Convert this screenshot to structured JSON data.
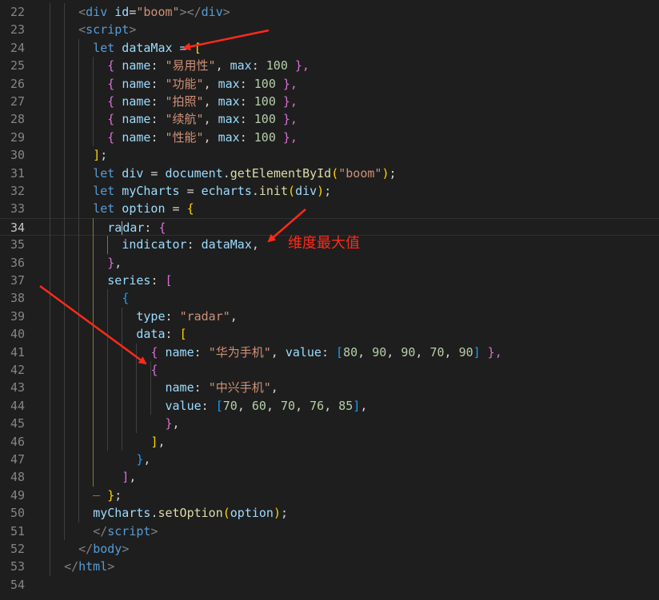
{
  "editor": {
    "lines": [
      {
        "number": "22",
        "tokens": [
          {
            "t": "<",
            "c": "t-brk"
          },
          {
            "t": "div",
            "c": "t-tag"
          },
          {
            "t": " id",
            "c": "t-attr"
          },
          {
            "t": "=",
            "c": "t-p"
          },
          {
            "t": "\"boom\"",
            "c": "t-str"
          },
          {
            "t": "></",
            "c": "t-brk"
          },
          {
            "t": "div",
            "c": "t-tag"
          },
          {
            "t": ">",
            "c": "t-brk"
          }
        ]
      },
      {
        "number": "23",
        "tokens": [
          {
            "t": "<",
            "c": "t-brk"
          },
          {
            "t": "script",
            "c": "t-tag"
          },
          {
            "t": ">",
            "c": "t-brk"
          }
        ]
      },
      {
        "number": "24",
        "tokens": [
          {
            "t": "let",
            "c": "t-kw"
          },
          {
            "t": " dataMax = ",
            "c": "t-var"
          },
          {
            "t": "[",
            "c": "b1"
          }
        ]
      },
      {
        "number": "25",
        "tokens": [
          {
            "t": "{ ",
            "c": "b2"
          },
          {
            "t": "name",
            "c": "t-var"
          },
          {
            "t": ": ",
            "c": "t-p"
          },
          {
            "t": "\"易用性\"",
            "c": "t-str"
          },
          {
            "t": ", ",
            "c": "t-p"
          },
          {
            "t": "max",
            "c": "t-var"
          },
          {
            "t": ": ",
            "c": "t-p"
          },
          {
            "t": "100",
            "c": "t-num"
          },
          {
            "t": " },",
            "c": "b2"
          }
        ]
      },
      {
        "number": "26",
        "tokens": [
          {
            "t": "{ ",
            "c": "b2"
          },
          {
            "t": "name",
            "c": "t-var"
          },
          {
            "t": ": ",
            "c": "t-p"
          },
          {
            "t": "\"功能\"",
            "c": "t-str"
          },
          {
            "t": ", ",
            "c": "t-p"
          },
          {
            "t": "max",
            "c": "t-var"
          },
          {
            "t": ": ",
            "c": "t-p"
          },
          {
            "t": "100",
            "c": "t-num"
          },
          {
            "t": " },",
            "c": "b2"
          }
        ]
      },
      {
        "number": "27",
        "tokens": [
          {
            "t": "{ ",
            "c": "b2"
          },
          {
            "t": "name",
            "c": "t-var"
          },
          {
            "t": ": ",
            "c": "t-p"
          },
          {
            "t": "\"拍照\"",
            "c": "t-str"
          },
          {
            "t": ", ",
            "c": "t-p"
          },
          {
            "t": "max",
            "c": "t-var"
          },
          {
            "t": ": ",
            "c": "t-p"
          },
          {
            "t": "100",
            "c": "t-num"
          },
          {
            "t": " },",
            "c": "b2"
          }
        ]
      },
      {
        "number": "28",
        "tokens": [
          {
            "t": "{ ",
            "c": "b2"
          },
          {
            "t": "name",
            "c": "t-var"
          },
          {
            "t": ": ",
            "c": "t-p"
          },
          {
            "t": "\"续航\"",
            "c": "t-str"
          },
          {
            "t": ", ",
            "c": "t-p"
          },
          {
            "t": "max",
            "c": "t-var"
          },
          {
            "t": ": ",
            "c": "t-p"
          },
          {
            "t": "100",
            "c": "t-num"
          },
          {
            "t": " },",
            "c": "b2"
          }
        ]
      },
      {
        "number": "29",
        "tokens": [
          {
            "t": "{ ",
            "c": "b2"
          },
          {
            "t": "name",
            "c": "t-var"
          },
          {
            "t": ": ",
            "c": "t-p"
          },
          {
            "t": "\"性能\"",
            "c": "t-str"
          },
          {
            "t": ", ",
            "c": "t-p"
          },
          {
            "t": "max",
            "c": "t-var"
          },
          {
            "t": ": ",
            "c": "t-p"
          },
          {
            "t": "100",
            "c": "t-num"
          },
          {
            "t": " },",
            "c": "b2"
          }
        ]
      },
      {
        "number": "30",
        "tokens": [
          {
            "t": "]",
            "c": "b1"
          },
          {
            "t": ";",
            "c": "t-p"
          }
        ]
      },
      {
        "number": "31",
        "tokens": [
          {
            "t": "let",
            "c": "t-kw"
          },
          {
            "t": " div",
            "c": "t-var"
          },
          {
            "t": " = ",
            "c": "t-p"
          },
          {
            "t": "document",
            "c": "t-var"
          },
          {
            "t": ".",
            "c": "t-p"
          },
          {
            "t": "getElementById",
            "c": "t-fn"
          },
          {
            "t": "(",
            "c": "b1"
          },
          {
            "t": "\"boom\"",
            "c": "t-str"
          },
          {
            "t": ")",
            "c": "b1"
          },
          {
            "t": ";",
            "c": "t-p"
          }
        ]
      },
      {
        "number": "32",
        "tokens": [
          {
            "t": "let",
            "c": "t-kw"
          },
          {
            "t": " myCharts",
            "c": "t-var"
          },
          {
            "t": " = ",
            "c": "t-p"
          },
          {
            "t": "echarts",
            "c": "t-var"
          },
          {
            "t": ".",
            "c": "t-p"
          },
          {
            "t": "init",
            "c": "t-fn"
          },
          {
            "t": "(",
            "c": "b1"
          },
          {
            "t": "div",
            "c": "t-var"
          },
          {
            "t": ")",
            "c": "b1"
          },
          {
            "t": ";",
            "c": "t-p"
          }
        ]
      },
      {
        "number": "33",
        "tokens": [
          {
            "t": "let",
            "c": "t-kw"
          },
          {
            "t": " option",
            "c": "t-var"
          },
          {
            "t": " = ",
            "c": "t-p"
          },
          {
            "t": "{",
            "c": "b1"
          }
        ]
      },
      {
        "number": "34",
        "current": true,
        "tokens": [
          {
            "t": "ra",
            "c": "t-var"
          },
          {
            "t": "|",
            "c": "caret"
          },
          {
            "t": "dar",
            "c": "t-var"
          },
          {
            "t": ": ",
            "c": "t-p"
          },
          {
            "t": "{",
            "c": "b2"
          }
        ]
      },
      {
        "number": "35",
        "tokens": [
          {
            "t": "indicator",
            "c": "t-var"
          },
          {
            "t": ": ",
            "c": "t-p"
          },
          {
            "t": "dataMax",
            "c": "t-var"
          },
          {
            "t": ",",
            "c": "t-p"
          }
        ]
      },
      {
        "number": "36",
        "tokens": [
          {
            "t": "}",
            "c": "b2"
          },
          {
            "t": ",",
            "c": "t-p"
          }
        ]
      },
      {
        "number": "37",
        "tokens": [
          {
            "t": "series",
            "c": "t-var"
          },
          {
            "t": ": ",
            "c": "t-p"
          },
          {
            "t": "[",
            "c": "b2"
          }
        ]
      },
      {
        "number": "38",
        "tokens": [
          {
            "t": "{",
            "c": "b3"
          }
        ]
      },
      {
        "number": "39",
        "tokens": [
          {
            "t": "type",
            "c": "t-var"
          },
          {
            "t": ": ",
            "c": "t-p"
          },
          {
            "t": "\"radar\"",
            "c": "t-str"
          },
          {
            "t": ",",
            "c": "t-p"
          }
        ]
      },
      {
        "number": "40",
        "tokens": [
          {
            "t": "data",
            "c": "t-var"
          },
          {
            "t": ": ",
            "c": "t-p"
          },
          {
            "t": "[",
            "c": "b1"
          }
        ]
      },
      {
        "number": "41",
        "tokens": [
          {
            "t": "{ ",
            "c": "b2"
          },
          {
            "t": "name",
            "c": "t-var"
          },
          {
            "t": ": ",
            "c": "t-p"
          },
          {
            "t": "\"华为手机\"",
            "c": "t-str"
          },
          {
            "t": ", ",
            "c": "t-p"
          },
          {
            "t": "value",
            "c": "t-var"
          },
          {
            "t": ": ",
            "c": "t-p"
          },
          {
            "t": "[",
            "c": "b3"
          },
          {
            "t": "80",
            "c": "t-num"
          },
          {
            "t": ", ",
            "c": "t-p"
          },
          {
            "t": "90",
            "c": "t-num"
          },
          {
            "t": ", ",
            "c": "t-p"
          },
          {
            "t": "90",
            "c": "t-num"
          },
          {
            "t": ", ",
            "c": "t-p"
          },
          {
            "t": "70",
            "c": "t-num"
          },
          {
            "t": ", ",
            "c": "t-p"
          },
          {
            "t": "90",
            "c": "t-num"
          },
          {
            "t": "]",
            "c": "b3"
          },
          {
            "t": " },",
            "c": "b2"
          }
        ]
      },
      {
        "number": "42",
        "tokens": [
          {
            "t": "{",
            "c": "b2"
          }
        ]
      },
      {
        "number": "43",
        "tokens": [
          {
            "t": "name",
            "c": "t-var"
          },
          {
            "t": ": ",
            "c": "t-p"
          },
          {
            "t": "\"中兴手机\"",
            "c": "t-str"
          },
          {
            "t": ",",
            "c": "t-p"
          }
        ]
      },
      {
        "number": "44",
        "tokens": [
          {
            "t": "value",
            "c": "t-var"
          },
          {
            "t": ": ",
            "c": "t-p"
          },
          {
            "t": "[",
            "c": "b3"
          },
          {
            "t": "70",
            "c": "t-num"
          },
          {
            "t": ", ",
            "c": "t-p"
          },
          {
            "t": "60",
            "c": "t-num"
          },
          {
            "t": ", ",
            "c": "t-p"
          },
          {
            "t": "70",
            "c": "t-num"
          },
          {
            "t": ", ",
            "c": "t-p"
          },
          {
            "t": "76",
            "c": "t-num"
          },
          {
            "t": ", ",
            "c": "t-p"
          },
          {
            "t": "85",
            "c": "t-num"
          },
          {
            "t": "]",
            "c": "b3"
          },
          {
            "t": ",",
            "c": "t-p"
          }
        ]
      },
      {
        "number": "45",
        "tokens": [
          {
            "t": "}",
            "c": "b2"
          },
          {
            "t": ",",
            "c": "t-p"
          }
        ]
      },
      {
        "number": "46",
        "tokens": [
          {
            "t": "]",
            "c": "b1"
          },
          {
            "t": ",",
            "c": "t-p"
          }
        ]
      },
      {
        "number": "47",
        "tokens": [
          {
            "t": "}",
            "c": "b3"
          },
          {
            "t": ",",
            "c": "t-p"
          }
        ]
      },
      {
        "number": "48",
        "tokens": [
          {
            "t": "]",
            "c": "b2"
          },
          {
            "t": ",",
            "c": "t-p"
          }
        ]
      },
      {
        "number": "49",
        "tokens": [
          {
            "t": "}",
            "c": "b1"
          },
          {
            "t": ";",
            "c": "t-p"
          }
        ]
      },
      {
        "number": "50",
        "tokens": [
          {
            "t": "myCharts",
            "c": "t-var"
          },
          {
            "t": ".",
            "c": "t-p"
          },
          {
            "t": "setOption",
            "c": "t-fn"
          },
          {
            "t": "(",
            "c": "b1"
          },
          {
            "t": "option",
            "c": "t-var"
          },
          {
            "t": ")",
            "c": "b1"
          },
          {
            "t": ";",
            "c": "t-p"
          }
        ]
      },
      {
        "number": "51",
        "tokens": [
          {
            "t": "</",
            "c": "t-brk"
          },
          {
            "t": "script",
            "c": "t-tag"
          },
          {
            "t": ">",
            "c": "t-brk"
          }
        ]
      },
      {
        "number": "52",
        "tokens": [
          {
            "t": "</",
            "c": "t-brk"
          },
          {
            "t": "body",
            "c": "t-tag"
          },
          {
            "t": ">",
            "c": "t-brk"
          }
        ]
      },
      {
        "number": "53",
        "tokens": [
          {
            "t": "</",
            "c": "t-brk"
          },
          {
            "t": "html",
            "c": "t-tag"
          },
          {
            "t": ">",
            "c": "t-brk"
          }
        ]
      },
      {
        "number": "54",
        "tokens": []
      }
    ]
  },
  "annotation": {
    "text": "维度最大值",
    "color": "#ff2a1a",
    "arrows": 3
  },
  "theme": {
    "background": "#1e1e1e",
    "line_number": "#858585",
    "keyword": "#569cd6",
    "string": "#ce9178",
    "number": "#b5cea8"
  }
}
